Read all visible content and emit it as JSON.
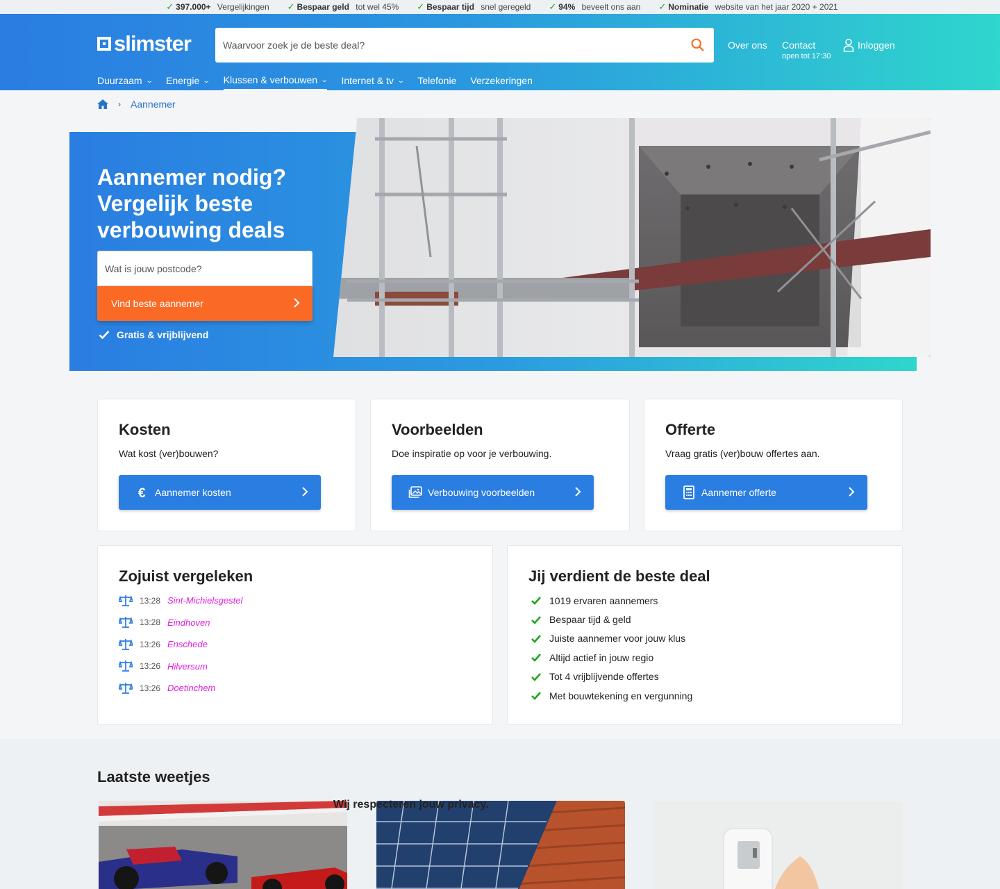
{
  "usp": [
    {
      "bold": "397.000+",
      "text": "Vergelijkingen"
    },
    {
      "bold": "Bespaar geld",
      "text": "tot wel 45%"
    },
    {
      "bold": "Bespaar tijd",
      "text": "snel geregeld"
    },
    {
      "bold": "94%",
      "text": "beveelt ons aan"
    },
    {
      "bold": "Nominatie",
      "text": "website van het jaar 2020 + 2021"
    }
  ],
  "header": {
    "logo": "slimster",
    "search_placeholder": "Waarvoor zoek je de beste deal?",
    "over": "Over ons",
    "contact": "Contact",
    "contact_sub": "open tot 17:30",
    "login": "Inloggen",
    "nav": [
      "Duurzaam",
      "Energie",
      "Klussen & verbouwen",
      "Internet & tv",
      "Telefonie",
      "Verzekeringen"
    ]
  },
  "breadcrumb": {
    "current": "Aannemer"
  },
  "hero": {
    "title_line1": "Aannemer nodig?",
    "title_line2": "Vergelijk beste",
    "title_line3": "verbouwing deals",
    "postcode_placeholder": "Wat is jouw postcode?",
    "cta": "Vind beste aannemer",
    "gratis": "Gratis & vrijblijvend"
  },
  "cards": [
    {
      "title": "Kosten",
      "text": "Wat kost (ver)bouwen?",
      "button": "Aannemer kosten",
      "icon": "euro-icon"
    },
    {
      "title": "Voorbeelden",
      "text": "Doe inspiratie op voor je verbouwing.",
      "button": "Verbouwing voorbeelden",
      "icon": "images-icon"
    },
    {
      "title": "Offerte",
      "text": "Vraag gratis (ver)bouw offertes aan.",
      "button": "Aannemer offerte",
      "icon": "calculator-icon"
    }
  ],
  "recent": {
    "title": "Zojuist vergeleken",
    "rows": [
      {
        "time": "13:28",
        "city": "Sint-Michielsgestel"
      },
      {
        "time": "13:28",
        "city": "Eindhoven"
      },
      {
        "time": "13:26",
        "city": "Enschede"
      },
      {
        "time": "13:26",
        "city": "Hilversum"
      },
      {
        "time": "13:26",
        "city": "Doetinchem"
      }
    ]
  },
  "deal": {
    "title": "Jij verdient de beste deal",
    "items": [
      "1019 ervaren aannemers",
      "Bespaar tijd & geld",
      "Juiste aannemer voor jouw klus",
      "Altijd actief in jouw regio",
      "Tot 4 vrijblijvende offertes",
      "Met bouwtekening en vergunning"
    ]
  },
  "weetjes": {
    "title": "Laatste weetjes",
    "privacy": "Wij respecteren jouw privacy."
  },
  "colors": {
    "primary": "#2a7de1",
    "accent": "#fb6a25",
    "teal": "#2fd6cd",
    "check": "#1ca51c"
  }
}
